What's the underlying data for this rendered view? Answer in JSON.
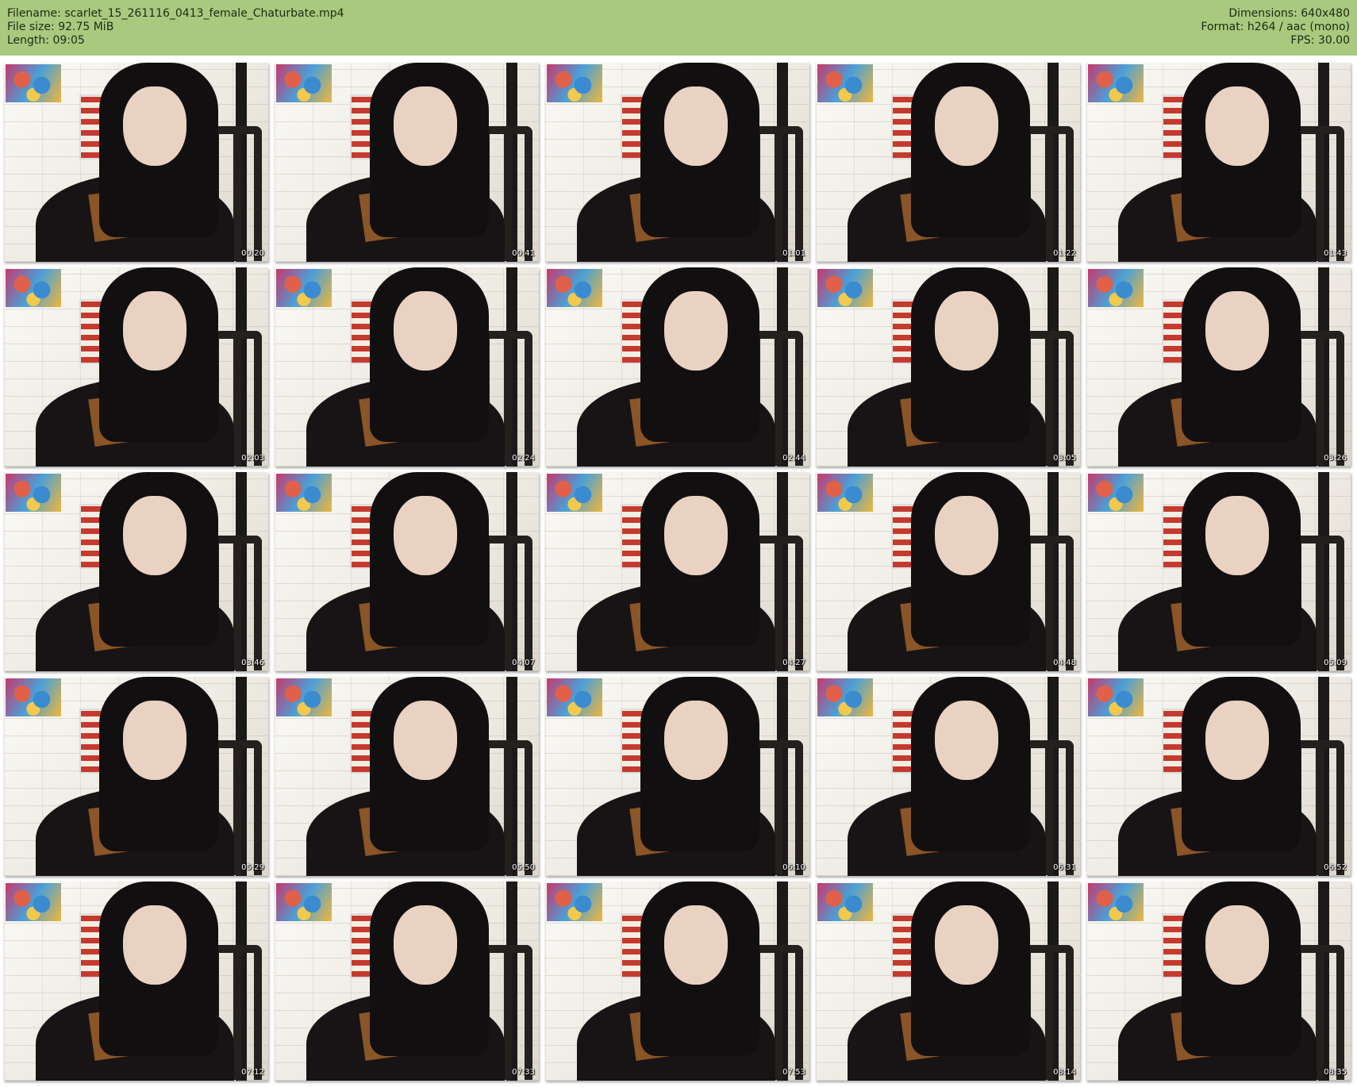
{
  "header": {
    "filename_label": "Filename:",
    "filename": "scarlet_15_261116_0413_female_Chaturbate.mp4",
    "filesize_label": "File size:",
    "filesize": "92.75 MiB",
    "length_label": "Length:",
    "length": "09:05",
    "dimensions_label": "Dimensions:",
    "dimensions": "640x480",
    "format_label": "Format:",
    "format": "h264 / aac (mono)",
    "fps_label": "FPS:",
    "fps": "30.00",
    "background_color": "#a9c97f"
  },
  "thumbnails": [
    {
      "timestamp": "00:20"
    },
    {
      "timestamp": "00:41"
    },
    {
      "timestamp": "01:01"
    },
    {
      "timestamp": "01:22"
    },
    {
      "timestamp": "01:43"
    },
    {
      "timestamp": "02:03"
    },
    {
      "timestamp": "02:24"
    },
    {
      "timestamp": "02:44"
    },
    {
      "timestamp": "03:05"
    },
    {
      "timestamp": "03:26"
    },
    {
      "timestamp": "03:46"
    },
    {
      "timestamp": "04:07"
    },
    {
      "timestamp": "04:27"
    },
    {
      "timestamp": "04:48"
    },
    {
      "timestamp": "05:09"
    },
    {
      "timestamp": "05:29"
    },
    {
      "timestamp": "05:50"
    },
    {
      "timestamp": "06:10"
    },
    {
      "timestamp": "06:31"
    },
    {
      "timestamp": "06:52"
    },
    {
      "timestamp": "07:12"
    },
    {
      "timestamp": "07:33"
    },
    {
      "timestamp": "07:53"
    },
    {
      "timestamp": "08:14"
    },
    {
      "timestamp": "08:35"
    }
  ]
}
